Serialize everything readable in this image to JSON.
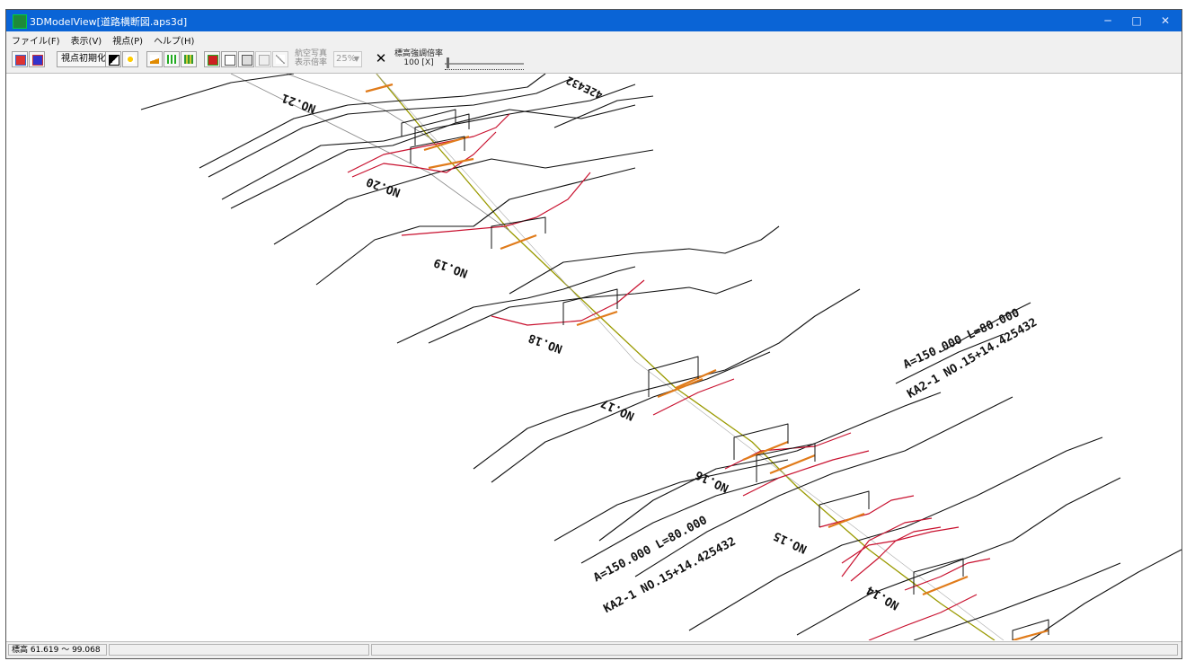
{
  "window": {
    "title": "3DModelView[道路横断図.aps3d]",
    "minimize_glyph": "─",
    "maximize_glyph": "□",
    "close_glyph": "✕"
  },
  "menu": [
    "ファイル(F)",
    "表示(V)",
    "視点(P)",
    "ヘルプ(H)"
  ],
  "toolbar": {
    "reset_view_label": "視点初期化",
    "display_ratio_label_line1": "航空写真",
    "display_ratio_label_line2": "表示倍率",
    "display_ratio_value": "25%",
    "cancel_glyph": "✕",
    "elevation_ratio_label": "標高強調倍率",
    "elevation_ratio_value": "100 [X]",
    "elevation_slider_value": 0.02,
    "icons": [
      {
        "name": "model-color-icon",
        "color": "#d33"
      },
      {
        "name": "model-shade-icon",
        "color": "#33c"
      },
      {
        "name": "contrast-icon",
        "color": "#000"
      },
      {
        "name": "light-icon",
        "color": "#e8c000"
      },
      {
        "name": "terrain-icon",
        "color": "#e08a00"
      },
      {
        "name": "bar-chart-icon",
        "color": "#2a2"
      },
      {
        "name": "section-chart-icon",
        "color": "#393"
      },
      {
        "name": "solid-icon",
        "color": "#c22"
      },
      {
        "name": "print-preview-icon",
        "color": "#555"
      },
      {
        "name": "save-image-icon",
        "color": "#555"
      },
      {
        "name": "aerial-photo-icon",
        "color": "#999"
      },
      {
        "name": "measure-icon",
        "color": "#999"
      }
    ]
  },
  "canvas": {
    "section_labels": [
      "NO.21",
      "NO.20",
      "NO.19",
      "NO.18",
      "NO.17",
      "NO.16",
      "NO.15",
      "NO.14"
    ],
    "top_curve_label": "42E432",
    "curve_upper_line1": "A=150.000  L=80.000",
    "curve_upper_line2": "KA2-1  NO.15+14.425432",
    "curve_lower_line1": "A=150.000  L=80.000",
    "curve_lower_line2": "KA2-1  NO.15+14.425432",
    "colors": {
      "terrain": "#000000",
      "road": "#c8102e",
      "centerline": "#9a9a00",
      "pavement": "#e07b1a"
    }
  },
  "status": {
    "elevation_range": "標高 61.619 ～ 99.068"
  }
}
